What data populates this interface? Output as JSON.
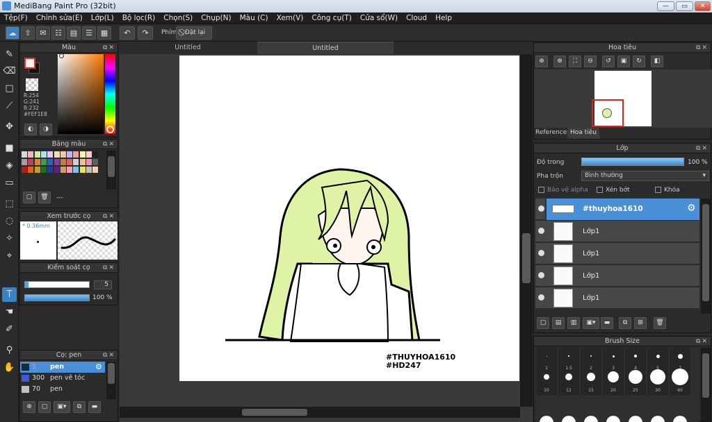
{
  "window": {
    "title": "MediBang Paint Pro (32bit)",
    "min": "—",
    "max": "▭",
    "close": "✕"
  },
  "menu": [
    "Tệp(F)",
    "Chỉnh sửa(E)",
    "Lớp(L)",
    "Bộ lọc(R)",
    "Chọn(S)",
    "Chụp(N)",
    "Màu (C)",
    "Xem(V)",
    "Công cụ(T)",
    "Cửa sổ(W)",
    "Cloud",
    "Help"
  ],
  "toolbar": {
    "phim_label": "Phím",
    "reset_label": "Đặt lại"
  },
  "tabs": [
    "Untitled",
    "Untitled"
  ],
  "color_panel": {
    "title": "Màu",
    "r": "R:254",
    "g": "G:241",
    "b": "B:232",
    "hex": "#FEF1E8",
    "fg": "#fef1e8"
  },
  "palette_panel": {
    "title": "Bảng màu",
    "sep": "---",
    "colors": [
      "#d8d8d8",
      "#f5b6c3",
      "#c8f0a0",
      "#b0e0f5",
      "#e6c8f0",
      "#f0e0b0",
      "#f5c8a0",
      "#b8b8f0",
      "#f0a0a0",
      "#f5f5b0",
      "#f8d0d0",
      "#202020",
      "#a0a0a0",
      "#c04060",
      "#e08030",
      "#40a040",
      "#3060c0",
      "#8040a0",
      "#c08040",
      "#e06060",
      "#d0d0d0",
      "#f0c090",
      "#f090b0",
      "#606060",
      "#b02020",
      "#e06020",
      "#c0a020",
      "#207020",
      "#2040a0",
      "#602080",
      "#d0a060",
      "#f0a0c0",
      "#80c0e0",
      "#f0e060",
      "#c0c0c0",
      "#f0d0b0"
    ]
  },
  "preview_panel": {
    "title": "Xem trước cọ",
    "size": "0.36mm"
  },
  "brush_control": {
    "title": "Kiểm soát cọ",
    "size": "5",
    "opacity": "100 %",
    "opacity_val": 1.0
  },
  "brush_panel": {
    "title": "Cọ: pen",
    "items": [
      {
        "size": "5",
        "name": "pen",
        "color": "#1a2a3a"
      },
      {
        "size": "300",
        "name": "pen vẽ tóc",
        "color": "#3a5bdc"
      },
      {
        "size": "70",
        "name": "pen",
        "color": "#c0c0c0"
      }
    ]
  },
  "navigator": {
    "title": "Hoa tiêu",
    "tab_reference": "Reference",
    "tab_navigator": "Hoa tiêu"
  },
  "layer_panel": {
    "title": "Lớp",
    "opacity_label": "Độ trong",
    "opacity_value": "100 %",
    "opacity_val": 1.0,
    "blend_label": "Pha trộn",
    "blend_value": "Bình thường",
    "protect_alpha": "Bảo vệ alpha",
    "clipping": "Xén bớt",
    "lock": "Khóa",
    "layers": [
      "#thuyhoa1610",
      "Lớp1",
      "Lớp1",
      "Lớp1",
      "Lớp1"
    ]
  },
  "brush_size_panel": {
    "title": "Brush Size",
    "sizes": [
      "1",
      "1.5",
      "2",
      "3",
      "4",
      "5",
      "7",
      "10",
      "12",
      "15",
      "20",
      "25",
      "30",
      "40"
    ]
  },
  "artwork": {
    "watermark1": "#THUYHOA1610",
    "watermark2": "#HD247"
  }
}
